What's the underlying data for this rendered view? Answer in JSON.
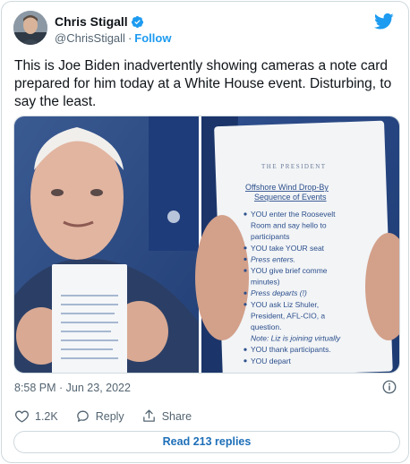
{
  "author": {
    "name": "Chris Stigall",
    "handle": "@ChrisStigall",
    "separator": "·",
    "follow_label": "Follow"
  },
  "tweet": {
    "text": "This is Joe Biden inadvertently showing cameras a note card prepared for him today at a White House event.  Disturbing, to say the least."
  },
  "note_card": {
    "header": "THE PRESIDENT",
    "title_line1": "Offshore Wind Drop-By",
    "title_line2": "Sequence of Events",
    "items": [
      "YOU enter the Roosevelt",
      "Room and say hello to",
      "participants",
      "YOU take YOUR seat",
      "Press enters.",
      "YOU give brief comme",
      "minutes)",
      "Press departs (!)",
      "YOU ask Liz Shuler,",
      "President, AFL-CIO, a",
      "question.",
      "Note: Liz is joining virtually",
      "YOU thank participants.",
      "YOU depart"
    ]
  },
  "meta": {
    "timestamp": "8:58 PM · Jun 23, 2022"
  },
  "actions": {
    "likes": "1.2K",
    "reply_label": "Reply",
    "share_label": "Share"
  },
  "read_replies_label": "Read 213 replies",
  "colors": {
    "accent": "#1d9bf0",
    "text": "#0f1419",
    "muted": "#536471",
    "border": "#cfd9de"
  },
  "icons": [
    "verified-badge-icon",
    "twitter-bird-icon",
    "info-icon",
    "heart-icon",
    "reply-bubble-icon",
    "share-icon"
  ]
}
